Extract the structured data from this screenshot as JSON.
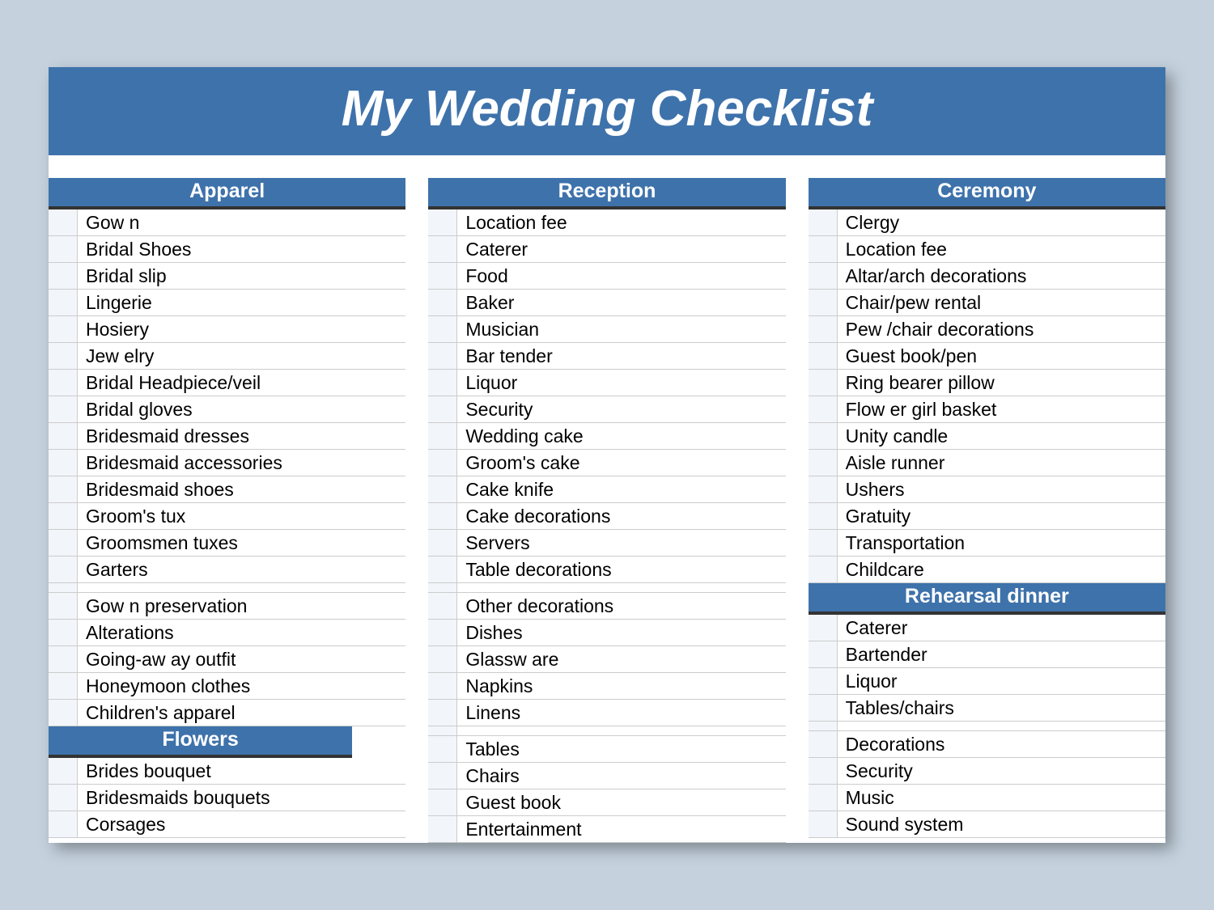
{
  "title": "My Wedding Checklist",
  "columns": [
    {
      "sections": [
        {
          "name": "Apparel",
          "items": [
            "Gow n",
            "Bridal Shoes",
            "Bridal slip",
            "Lingerie",
            "Hosiery",
            "Jew elry",
            "Bridal Headpiece/veil",
            "Bridal gloves",
            "Bridesmaid dresses",
            "Bridesmaid accessories",
            "Bridesmaid shoes",
            "Groom's tux",
            "Groomsmen tuxes",
            "Garters",
            "",
            "Gow n preservation",
            "Alterations",
            "Going-aw ay outfit",
            "Honeymoon clothes",
            "Children's apparel"
          ],
          "header_narrow": false
        },
        {
          "name": "Flowers",
          "items": [
            "Brides bouquet",
            "Bridesmaids bouquets",
            "Corsages"
          ],
          "header_narrow": true
        }
      ]
    },
    {
      "sections": [
        {
          "name": "Reception",
          "items": [
            "Location fee",
            "Caterer",
            "Food",
            "Baker",
            "Musician",
            "Bar tender",
            "Liquor",
            "Security",
            "Wedding cake",
            "Groom's cake",
            "Cake knife",
            "Cake decorations",
            "Servers",
            "Table decorations",
            "",
            "Other decorations",
            "Dishes",
            "Glassw are",
            "Napkins",
            "Linens",
            "",
            "Tables",
            "Chairs",
            "Guest book",
            "Entertainment"
          ],
          "header_narrow": false
        }
      ]
    },
    {
      "sections": [
        {
          "name": "Ceremony",
          "items": [
            "Clergy",
            "Location fee",
            "Altar/arch decorations",
            "Chair/pew rental",
            "Pew /chair decorations",
            "Guest book/pen",
            "Ring bearer pillow",
            "Flow er girl basket",
            "Unity candle",
            "Aisle runner",
            "Ushers",
            "Gratuity",
            "Transportation",
            "Childcare"
          ],
          "header_narrow": false
        },
        {
          "name": "Rehearsal dinner",
          "items": [
            "Caterer",
            "Bartender",
            "Liquor",
            "Tables/chairs",
            "",
            "Decorations",
            "Security",
            "Music",
            "Sound system"
          ],
          "header_narrow": false
        }
      ]
    }
  ]
}
